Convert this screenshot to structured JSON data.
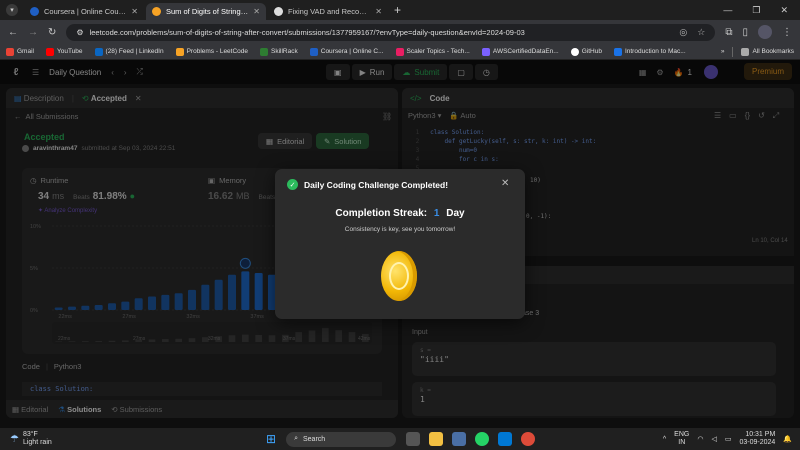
{
  "browser": {
    "tabs": [
      {
        "title": "Coursera | Online Courses From",
        "favicon_color": "#1f5fc4",
        "active": false
      },
      {
        "title": "Sum of Digits of String After C",
        "favicon_color": "#f7a325",
        "active": true
      },
      {
        "title": "Fixing VAD and Recognition",
        "favicon_color": "#dddddd",
        "active": false
      }
    ],
    "url": "leetcode.com/problems/sum-of-digits-of-string-after-convert/submissions/1377959167/?envType=daily-question&envId=2024-09-03",
    "bookmarks": [
      {
        "label": "Gmail",
        "color": "#ea4335"
      },
      {
        "label": "YouTube",
        "color": "#ff0000"
      },
      {
        "label": "(28) Feed | LinkedIn",
        "color": "#0a66c2"
      },
      {
        "label": "Problems - LeetCode",
        "color": "#f7a325"
      },
      {
        "label": "SkillRack",
        "color": "#2e7d32"
      },
      {
        "label": "Coursera | Online C...",
        "color": "#1f5fc4"
      },
      {
        "label": "Scaler Topics - Tech...",
        "color": "#e91e63"
      },
      {
        "label": "AWSCertifiedDataEn...",
        "color": "#7b61ff"
      },
      {
        "label": "GitHub",
        "color": "#ffffff"
      },
      {
        "label": "Introduction to Mac...",
        "color": "#1a73e8"
      }
    ],
    "all_bookmarks": "All Bookmarks",
    "more_bookmarks": "»"
  },
  "header": {
    "daily_question": "Daily Question",
    "run": "Run",
    "submit": "Submit",
    "streak_count": "1",
    "premium": "Premium"
  },
  "left": {
    "tabs": {
      "description": "Description",
      "accepted": "Accepted"
    },
    "all_submissions": "All Submissions",
    "status": "Accepted",
    "user": "aravinthram47",
    "submitted": "submitted at Sep 03, 2024 22:51",
    "editorial": "Editorial",
    "solution": "Solution",
    "runtime_label": "Runtime",
    "runtime_value": "34",
    "runtime_unit": "ms",
    "beats_label": "Beats",
    "beats_value": "81.98%",
    "memory_label": "Memory",
    "memory_value": "16.62",
    "memory_unit": "MB",
    "memory_beats_label": "Beats",
    "memory_beats_value": "5",
    "analyze": "Analyze Complexity",
    "code_label": "Code",
    "code_lang": "Python3",
    "code_line": "class Solution:",
    "bottom_tabs": {
      "editorial": "Editorial",
      "solutions": "Solutions",
      "submissions": "Submissions"
    }
  },
  "chart_data": {
    "type": "bar",
    "y_ticks": [
      "10%",
      "5%",
      "0%"
    ],
    "x_ticks": [
      "22ms",
      "27ms",
      "32ms",
      "37ms"
    ],
    "mini_x_ticks": [
      "22ms",
      "27ms",
      "32ms",
      "37ms",
      "42ms"
    ],
    "ylim": [
      0,
      10
    ],
    "values": [
      0.3,
      0.4,
      0.5,
      0.6,
      0.8,
      1.0,
      1.4,
      1.6,
      1.8,
      2.0,
      2.4,
      3.0,
      3.6,
      4.2,
      4.6,
      4.4,
      4.2,
      4.5,
      6.2,
      7.2,
      8.8,
      7.4,
      6.2,
      5.0
    ],
    "highlight_from": 14
  },
  "right": {
    "code_title": "Code",
    "lang": "Python3",
    "auto": "Auto",
    "code_lines": [
      "class Solution:",
      "    def getLucky(self, s: str, k: int) -> int:",
      "        num=0",
      "        for c in s:",
      "",
      "",
      "",
      "",
      "",
      ""
    ],
    "code_frag_1": "10)",
    "code_frag_2": "0, -1):",
    "cursor_pos": "Ln 10, Col 14",
    "case_label": "ase 3",
    "input_label": "Input",
    "s_label": "s =",
    "s_value": "\"iiii\"",
    "k_label": "k =",
    "k_value": "1"
  },
  "modal": {
    "title": "Daily Coding Challenge Completed!",
    "streak_label": "Completion Streak:",
    "streak_num": "1",
    "streak_unit": "Day",
    "subtitle": "Consistency is key, see you tomorrow!",
    "close": "✕"
  },
  "taskbar": {
    "temp": "83°F",
    "weather": "Light rain",
    "search": "Search",
    "lang1": "ENG",
    "lang2": "IN",
    "time": "10:31 PM",
    "date": "03-09-2024",
    "notif_count": "1"
  }
}
